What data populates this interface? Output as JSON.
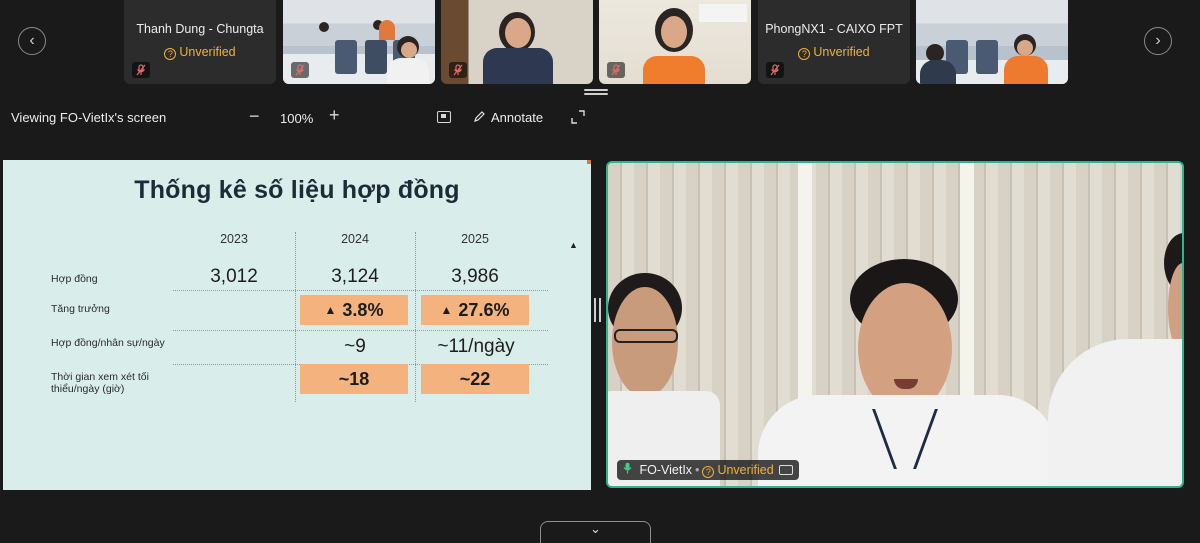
{
  "participants_strip": {
    "prev_glyph": "‹",
    "next_glyph": "›",
    "tiles": [
      {
        "name": "Thanh Dung - Chungta",
        "status": "Unverified",
        "type": "name-only"
      },
      {
        "type": "video",
        "scene": "office"
      },
      {
        "type": "video",
        "scene": "woman-shelf"
      },
      {
        "type": "video",
        "scene": "woman-window"
      },
      {
        "name": "PhongNX1 - CAIXO FPT",
        "status": "Unverified",
        "type": "name-only"
      },
      {
        "type": "video",
        "scene": "office-two"
      }
    ],
    "status_icon_glyph": "?"
  },
  "toolbar": {
    "viewing_label": "Viewing FO-VietIx's screen",
    "zoom_minus": "−",
    "zoom_value": "100%",
    "zoom_plus": "+",
    "annotate_label": "Annotate",
    "annotate_icon": "pen-icon"
  },
  "slide": {
    "title": "Thống kê số liệu hợp đồng",
    "columns": [
      "2023",
      "2024",
      "2025"
    ],
    "rows": [
      {
        "label": "Hợp đồng",
        "values": [
          "3,012",
          "3,124",
          "3,986"
        ],
        "highlight": false
      },
      {
        "label": "Tăng trưởng",
        "values": [
          "",
          "3.8%",
          "27.6%"
        ],
        "highlight": true,
        "arrow": "🡅"
      },
      {
        "label": "Hợp đồng/nhân sự/ngày",
        "values": [
          "",
          "~9",
          "~11/ngày"
        ],
        "highlight": false
      },
      {
        "label_lines": [
          "Thời gian xem xét tối",
          "thiểu/ngày (giờ)"
        ],
        "values": [
          "",
          "~18",
          "~22"
        ],
        "highlight": true
      }
    ],
    "highlight_color": "#f4b27e",
    "background_color": "#d9eeea"
  },
  "speaker": {
    "name": "FO-VietIx",
    "separator": "•",
    "status": "Unverified",
    "status_icon_glyph": "?",
    "border_color": "#2bb68f"
  },
  "bottom_tab": {
    "glyph": "⌄"
  }
}
